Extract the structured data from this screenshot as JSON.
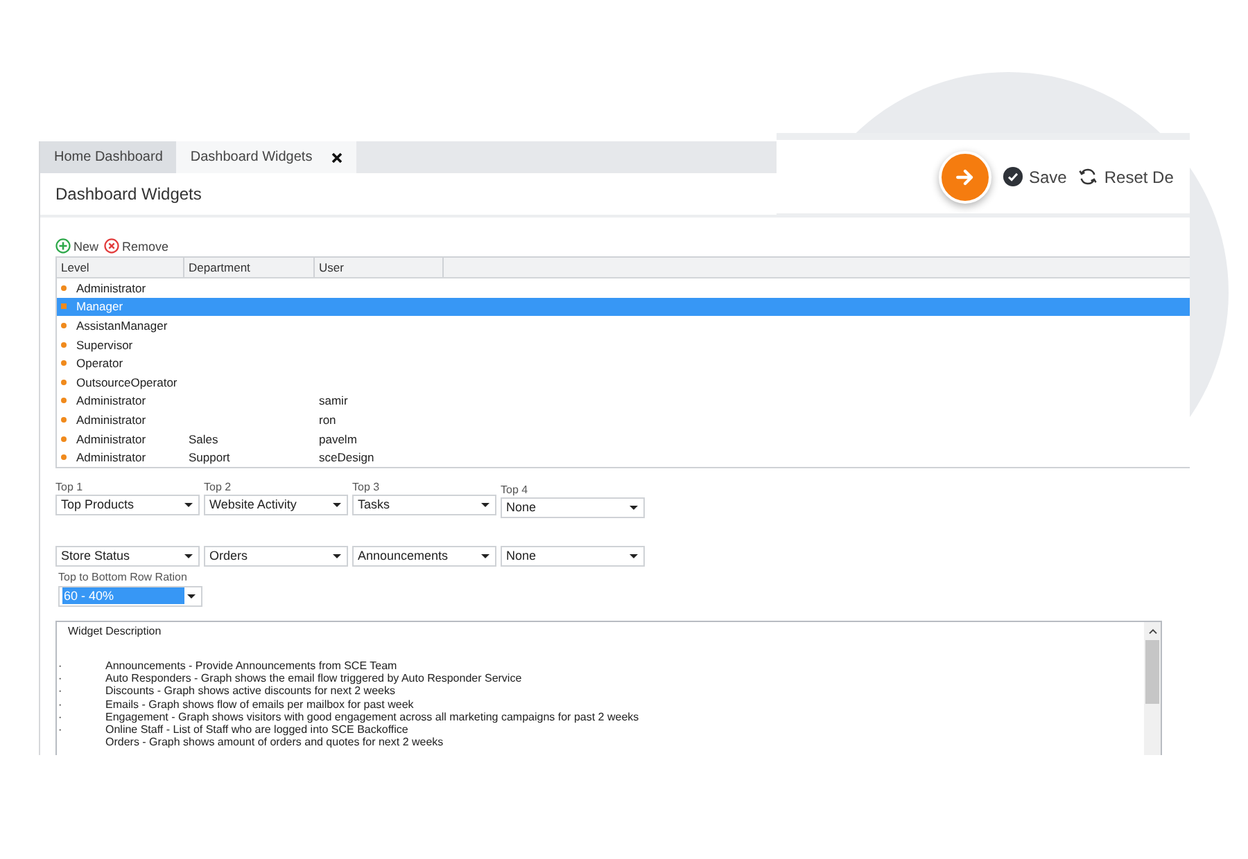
{
  "tabs": [
    {
      "label": "Home Dashboard",
      "selected": false,
      "closable": false
    },
    {
      "label": "Dashboard Widgets",
      "selected": true,
      "closable": true
    }
  ],
  "heading": "Dashboard Widgets",
  "actions": [
    {
      "label": "Save",
      "kind": "save"
    },
    {
      "label": "Reset De",
      "kind": "reset"
    }
  ],
  "toolbar": [
    {
      "label": "New",
      "kind": "add"
    },
    {
      "label": "Remove",
      "kind": "remove"
    }
  ],
  "grid": {
    "columns": [
      "Level",
      "Department",
      "User"
    ],
    "rows": [
      {
        "level": "Administrator",
        "department": "",
        "user": "",
        "selected": false
      },
      {
        "level": "Manager",
        "department": "",
        "user": "",
        "selected": true
      },
      {
        "level": "AssistanManager",
        "department": "",
        "user": "",
        "selected": false
      },
      {
        "level": "Supervisor",
        "department": "",
        "user": "",
        "selected": false
      },
      {
        "level": "Operator",
        "department": "",
        "user": "",
        "selected": false
      },
      {
        "level": "OutsourceOperator",
        "department": "",
        "user": "",
        "selected": false
      },
      {
        "level": "Administrator",
        "department": "",
        "user": "samir",
        "selected": false
      },
      {
        "level": "Administrator",
        "department": "",
        "user": "ron",
        "selected": false
      },
      {
        "level": "Administrator",
        "department": "Sales",
        "user": "pavelm",
        "selected": false
      },
      {
        "level": "Administrator",
        "department": "Support",
        "user": "sceDesign",
        "selected": false
      }
    ]
  },
  "top_row": [
    {
      "label": "Top 1",
      "value": "Top Products"
    },
    {
      "label": "Top 2",
      "value": "Website Activity"
    },
    {
      "label": "Top 3",
      "value": "Tasks"
    },
    {
      "label": "Top 4",
      "value": "None"
    }
  ],
  "bottom_row": [
    "Store Status",
    "Orders",
    "Announcements",
    "None"
  ],
  "ratio": {
    "label": "Top to Bottom Row Ration",
    "value": "60 - 40%",
    "focused": true
  },
  "description": {
    "title": "Widget Description",
    "items": [
      {
        "bullet": "·",
        "text": "Announcements - Provide Announcements from SCE Team"
      },
      {
        "bullet": "·",
        "text": "Auto Responders - Graph shows the email flow triggered by Auto Responder Service"
      },
      {
        "bullet": "·",
        "text": "Discounts - Graph shows active discounts for next 2 weeks"
      },
      {
        "bullet": "·",
        "text": "Emails - Graph shows flow of emails per mailbox for past week"
      },
      {
        "bullet": "·",
        "text": "Engagement - Graph shows visitors with good engagement across all marketing campaigns for past 2 weeks"
      },
      {
        "bullet": "·",
        "text": "Online Staff - List of Staff who are logged into SCE Backoffice"
      },
      {
        "text": "Orders - Graph shows amount of orders and quotes for next 2 weeks"
      }
    ]
  }
}
